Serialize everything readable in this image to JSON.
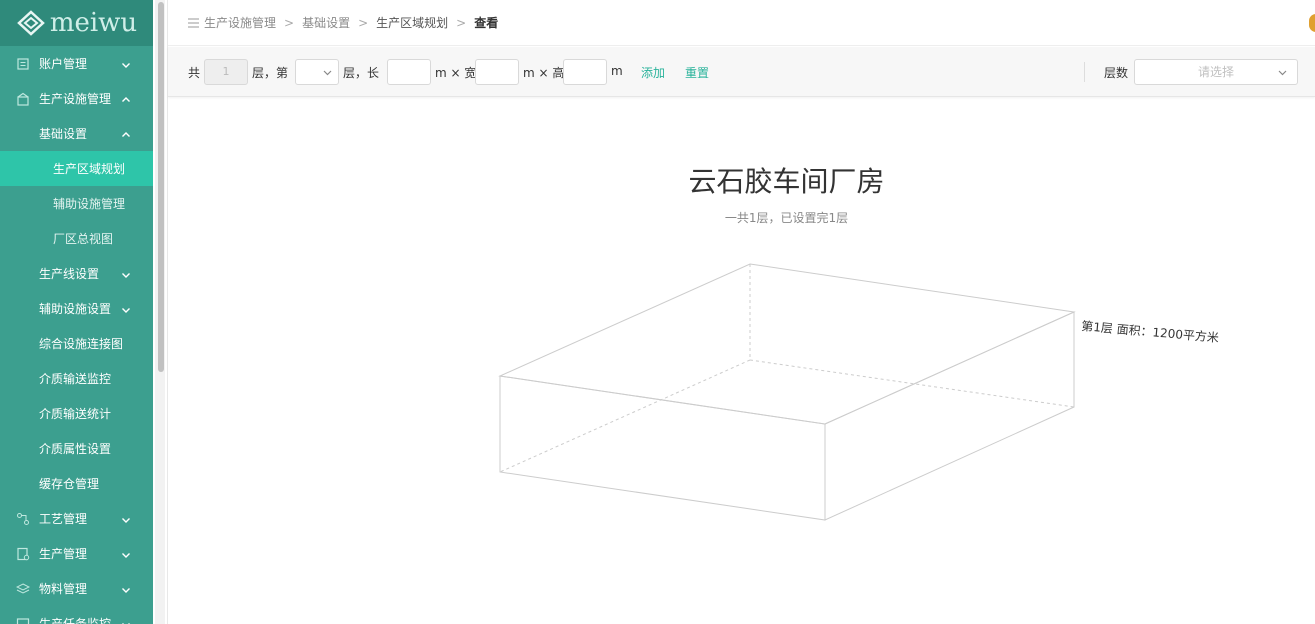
{
  "brand": {
    "logo_text": "meiwu"
  },
  "sidebar": {
    "items": [
      {
        "label": "账户管理",
        "level": 1,
        "icon": "document-icon",
        "expanded": false
      },
      {
        "label": "生产设施管理",
        "level": 1,
        "icon": "building-icon",
        "expanded": true
      },
      {
        "label": "基础设置",
        "level": 2,
        "expanded": true
      },
      {
        "label": "生产区域规划",
        "level": 3,
        "active": true
      },
      {
        "label": "辅助设施管理",
        "level": 3
      },
      {
        "label": "厂区总视图",
        "level": 3
      },
      {
        "label": "生产线设置",
        "level": 2,
        "expanded": false
      },
      {
        "label": "辅助设施设置",
        "level": 2,
        "expanded": false
      },
      {
        "label": "综合设施连接图",
        "level": 2
      },
      {
        "label": "介质输送监控",
        "level": 2
      },
      {
        "label": "介质输送统计",
        "level": 2
      },
      {
        "label": "介质属性设置",
        "level": 2
      },
      {
        "label": "缓存仓管理",
        "level": 2
      },
      {
        "label": "工艺管理",
        "level": 1,
        "icon": "process-icon",
        "expanded": false
      },
      {
        "label": "生产管理",
        "level": 1,
        "icon": "production-icon",
        "expanded": false
      },
      {
        "label": "物料管理",
        "level": 1,
        "icon": "layers-icon",
        "expanded": false
      },
      {
        "label": "生产任务监控",
        "level": 1,
        "icon": "monitor-icon",
        "expanded": false
      }
    ]
  },
  "breadcrumb": {
    "items": [
      "生产设施管理",
      "基础设置",
      "生产区域规划",
      "查看"
    ],
    "separator": ">"
  },
  "toolbar": {
    "total_prefix": "共",
    "total_value": "1",
    "total_suffix": "层，第",
    "floor_suffix": "层，长",
    "length_unit": "m × 宽",
    "width_unit": "m × 高",
    "height_unit": "m",
    "add_label": "添加",
    "reset_label": "重置",
    "floors_label": "层数",
    "floors_placeholder": "请选择"
  },
  "main": {
    "title": "云石胶车间厂房",
    "subtitle": "一共1层，已设置完1层",
    "floor_label": "第1层 面积：1200平方米"
  },
  "colors": {
    "sidebar_bg": "#3c9f8f",
    "sidebar_active": "#2ec5a9",
    "accent": "#2ab39b"
  }
}
